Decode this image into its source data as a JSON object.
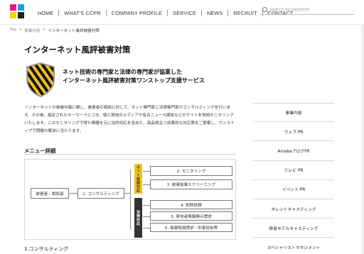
{
  "header": {
    "logo_colors": [
      "#e51b7a",
      "#1aa0e0",
      "#f2d21b",
      "#222222"
    ],
    "nav": [
      "HOME",
      "WHAT'S CCPR",
      "COMPANY PROFILE",
      "SERVICE",
      "NEWS",
      "RECRUIT",
      "CONTACT"
    ],
    "search_placeholder": "search by keyword"
  },
  "breadcrumb": {
    "items": [
      "Top",
      "事業内容"
    ],
    "separator": ">",
    "current": "インターネット風評被害対策"
  },
  "page": {
    "title": "インターネット風評被害対策",
    "catch_line1": "ネット技術の専門家と法律の専門家が協業した",
    "catch_line2": "インターネット風評被害対策ワンストップ支援サービス",
    "intro": "インターネットの後継中傷に関し、被害者の相談に対して、ネット専門家と法律専門家がコンサルティングを行います。その後、設定されたキーワードにつき、個人発信のメディアや有名ニュース媒体などのサイトを常時モニタリングいたします。このモニタリングで得た情報を元に法的対応を含めた、高品質且つ効果的な対応策をご提案し、ワンストップで問題の解決に当たります。",
    "menu_heading": "メニュー詳細",
    "section1": "1.コンサルティング"
  },
  "diagram": {
    "client": "被害者・相談者",
    "step1": "1. コンサルティング",
    "net_tab": "ネット技術対応",
    "legal_tab": "法律対応",
    "net_items": [
      "2. モニタリング",
      "3. 被害結果スクリーニング"
    ],
    "legal_items": [
      "4. 削除依頼",
      "5. 発信者情報開示請求",
      "6. 損害賠償請求・刑事告訴等"
    ],
    "net_color": "#f1c21b",
    "legal_color": "#333333"
  },
  "sidebar": {
    "items": [
      "事業内容",
      "ウェブ PR",
      "AmebaブログPR",
      "テレビ PR",
      "イベント PR",
      "タレントキャスティング",
      "読者モデルキャスティング",
      "スペシャリストマネジメント"
    ]
  }
}
